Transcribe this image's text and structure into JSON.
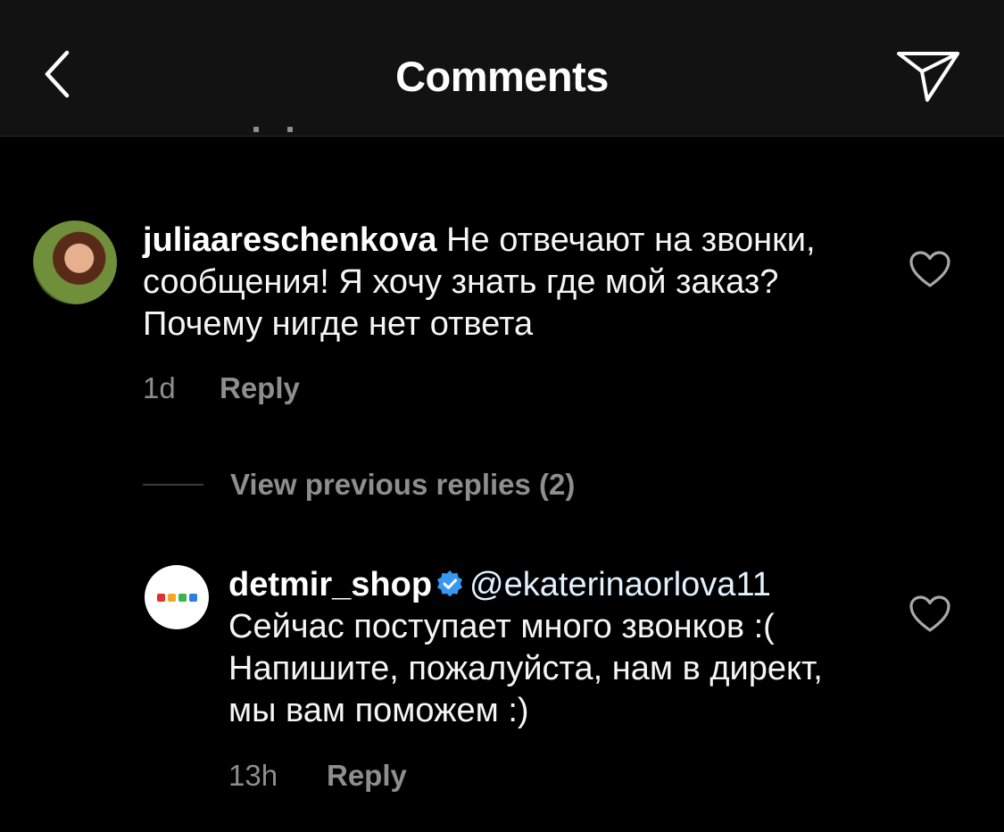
{
  "header": {
    "title": "Comments",
    "back_icon": "chevron-left-icon",
    "share_icon": "paper-plane-icon"
  },
  "comments": [
    {
      "username": "juliaareschenkova",
      "text": "Не отвечают на звонки, сообщения! Я хочу знать где мой заказ? Почему нигде нет ответа",
      "time": "1d",
      "reply_label": "Reply"
    },
    {
      "username": "detmir_shop",
      "verified": true,
      "mention": "@ekaterinaorlova11",
      "text": "Сейчас поступает много звонков :( Напишите, пожалуйста, нам в директ, мы вам поможем :)",
      "time": "13h",
      "reply_label": "Reply"
    }
  ],
  "view_previous": {
    "label": "View previous replies (2)"
  },
  "colors": {
    "background": "#000000",
    "header_bg": "#121212",
    "secondary_text": "#8e8e8e",
    "verified_blue": "#3897f0"
  }
}
